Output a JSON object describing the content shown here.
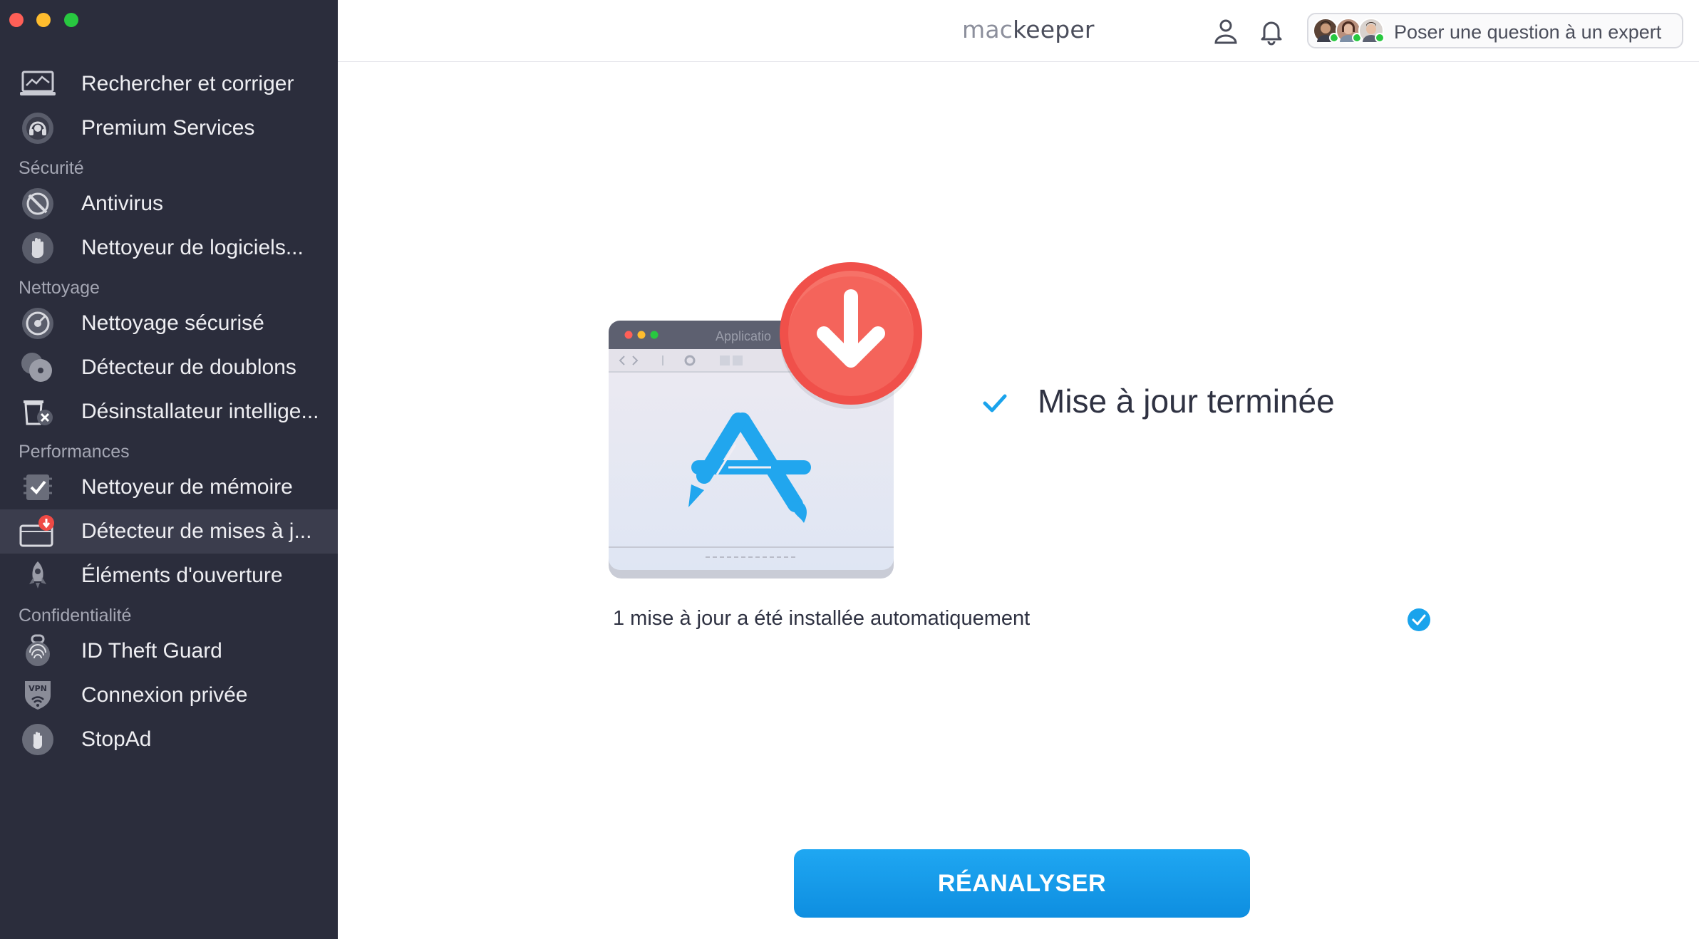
{
  "app": {
    "logo_part1": "mac",
    "logo_part2": "keeper"
  },
  "header": {
    "expert_button_label": "Poser une question à un expert",
    "icons": [
      "user-icon",
      "bell-icon"
    ]
  },
  "sidebar": {
    "items": [
      {
        "label": "Rechercher et corriger",
        "icon": "laptop-scan-icon"
      },
      {
        "label": "Premium Services",
        "icon": "headset-icon"
      },
      {
        "section": "Sécurité"
      },
      {
        "label": "Antivirus",
        "icon": "antivirus-icon"
      },
      {
        "label": "Nettoyeur de logiciels...",
        "icon": "hand-stop-icon"
      },
      {
        "section": "Nettoyage"
      },
      {
        "label": "Nettoyage sécurisé",
        "icon": "disk-clean-icon"
      },
      {
        "label": "Détecteur de doublons",
        "icon": "duplicate-discs-icon"
      },
      {
        "label": "Désinstallateur intellige...",
        "icon": "trash-x-icon"
      },
      {
        "section": "Performances"
      },
      {
        "label": "Nettoyeur de mémoire",
        "icon": "memory-check-icon"
      },
      {
        "label": "Détecteur de mises à j...",
        "icon": "update-window-icon",
        "active": true
      },
      {
        "label": "Éléments d'ouverture",
        "icon": "rocket-icon"
      },
      {
        "section": "Confidentialité"
      },
      {
        "label": "ID Theft Guard",
        "icon": "fingerprint-icon"
      },
      {
        "label": "Connexion privée",
        "icon": "vpn-shield-icon"
      },
      {
        "label": "StopAd",
        "icon": "stopad-hand-icon"
      }
    ]
  },
  "main": {
    "illustration_window_title": "Applicatio",
    "status_title": "Mise à jour terminée",
    "result_text": "1 mise à jour a été installée automatiquement",
    "rescan_button_label": "RÉANALYSER"
  },
  "colors": {
    "sidebar_bg": "#2b2d3c",
    "accent_blue": "#1a9ff0",
    "download_red": "#f0504a",
    "check_blue": "#1aa3ec"
  }
}
